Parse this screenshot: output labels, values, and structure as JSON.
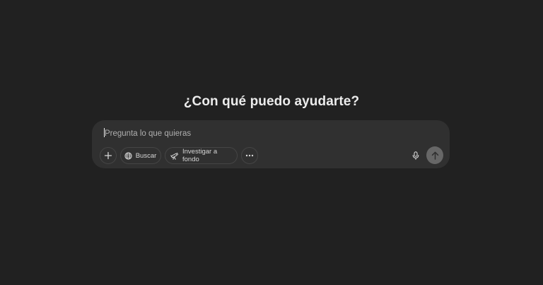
{
  "heading": "¿Con qué puedo ayudarte?",
  "composer": {
    "placeholder": "Pregunta lo que quieras",
    "tools": {
      "add_icon": "plus-icon",
      "search_label": "Buscar",
      "search_icon": "globe-icon",
      "research_label": "Investigar a fondo",
      "research_icon": "telescope-icon",
      "more_icon": "ellipsis-icon",
      "mic_icon": "microphone-icon",
      "send_icon": "arrow-up-icon"
    }
  },
  "colors": {
    "background": "#212121",
    "composer": "#303030",
    "send_button": "#676767",
    "text": "#ececec",
    "placeholder": "#afafaf"
  }
}
